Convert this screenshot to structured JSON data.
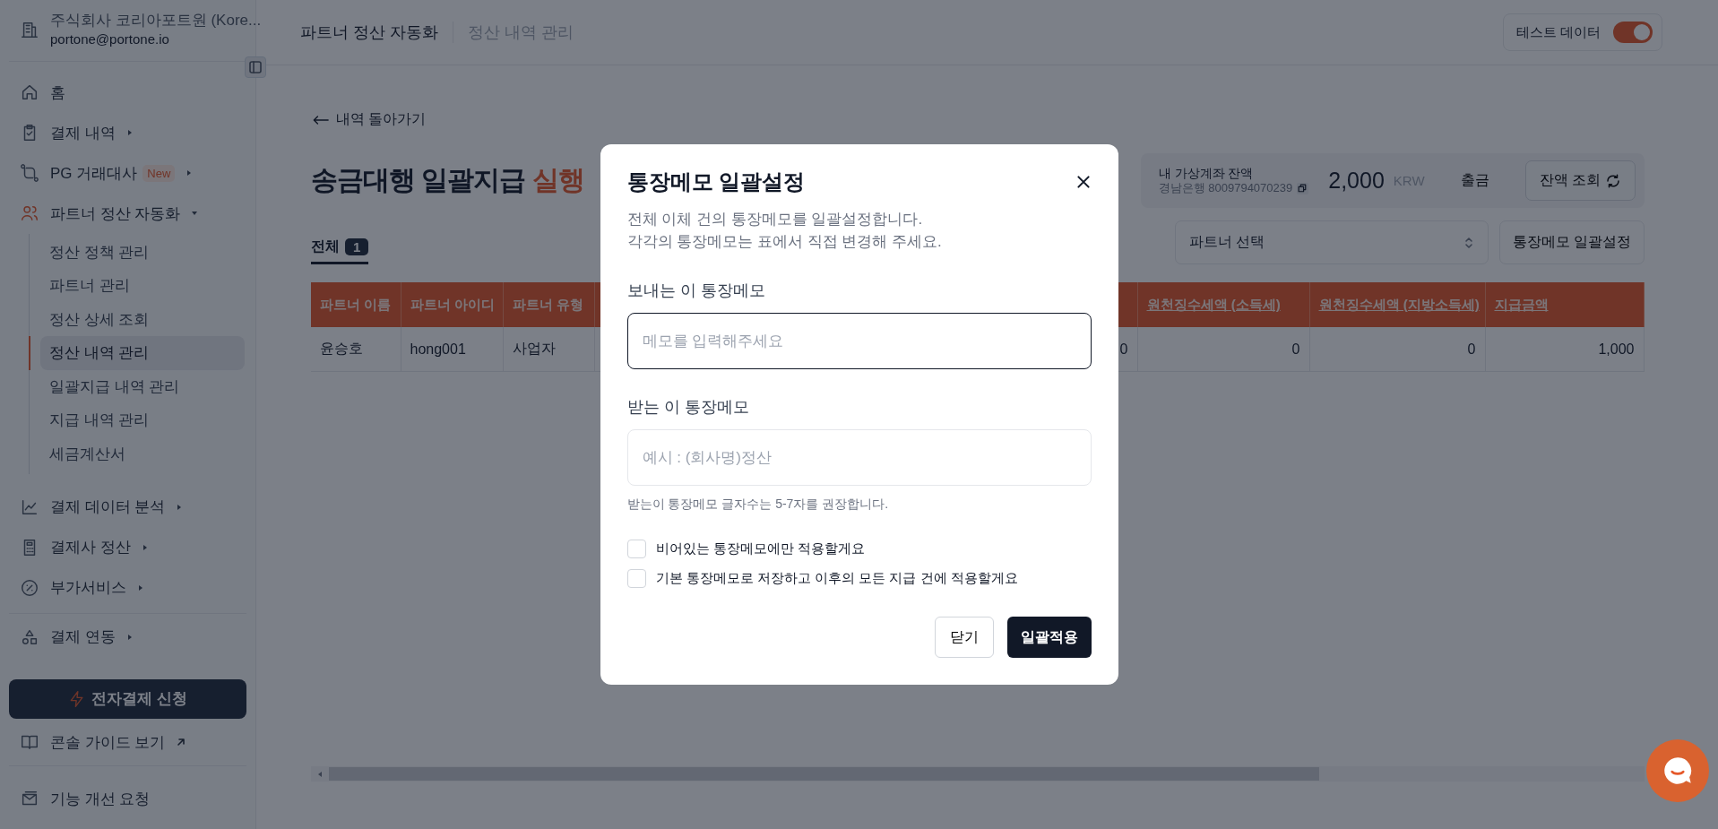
{
  "sidebar": {
    "account": {
      "company": "주식회사 코리아포트원 (Kore...",
      "email": "portone@portone.io"
    },
    "menu": [
      {
        "kind": "home",
        "label": "홈",
        "expandable": false,
        "expanded": false
      },
      {
        "kind": "receipt",
        "label": "결제 내역",
        "expandable": true,
        "expanded": false
      },
      {
        "kind": "pg",
        "label": "PG 거래대사",
        "badge": "New",
        "expandable": true,
        "expanded": false
      },
      {
        "kind": "partners",
        "label": "파트너 정산 자동화",
        "expandable": true,
        "expanded": true,
        "children": [
          {
            "label": "정산 정책 관리",
            "selected": false
          },
          {
            "label": "파트너 관리",
            "selected": false
          },
          {
            "label": "정산 상세 조회",
            "selected": false
          },
          {
            "label": "정산 내역 관리",
            "selected": true
          },
          {
            "label": "일괄지급 내역 관리",
            "selected": false
          },
          {
            "label": "지급 내역 관리",
            "selected": false
          },
          {
            "label": "세금계산서",
            "selected": false
          }
        ]
      },
      {
        "kind": "chart",
        "label": "결제 데이터 분석",
        "expandable": true,
        "expanded": false
      },
      {
        "kind": "calculator",
        "label": "결제사 정산",
        "expandable": true,
        "expanded": false
      },
      {
        "kind": "service",
        "label": "부가서비스",
        "expandable": true,
        "expanded": false
      }
    ],
    "integration_menu": [
      {
        "kind": "integration",
        "label": "결제 연동",
        "expandable": true,
        "expanded": false
      }
    ],
    "apply_button": "전자결제 신청",
    "guide_link": "콘솔 가이드 보기",
    "feedback_link": "기능 개선 요청"
  },
  "header": {
    "breadcrumbs": [
      "파트너 정산 자동화",
      "정산 내역 관리"
    ],
    "test_toggle": {
      "label": "테스트 데이터",
      "on": true
    }
  },
  "back_link": "내역 돌아가기",
  "title": {
    "text": "송금대행 일괄지급",
    "highlight": "실행"
  },
  "balance": {
    "label": "내 가상계좌 잔액",
    "account": "경남은행 8009794070239",
    "amount": "2,000",
    "currency": "KRW",
    "withdraw": "출금",
    "refresh": "잔액 조회"
  },
  "tabs": [
    {
      "label": "전체",
      "count": "1",
      "selected": true
    }
  ],
  "partner_select": {
    "placeholder": "파트너 선택"
  },
  "bulk_memo_button": "통장메모 일괄설정",
  "table": {
    "columns": [
      {
        "label": "파트너 이름",
        "underlined": false,
        "numeric": false
      },
      {
        "label": "파트너 아이디",
        "underlined": false,
        "numeric": false
      },
      {
        "label": "파트너 유형",
        "underlined": false,
        "numeric": false
      },
      {
        "numeric": true
      },
      {
        "label": "원천징수세액 (소득세)",
        "underlined": true,
        "numeric": true
      },
      {
        "label": "원천징수세액 (지방소득세)",
        "underlined": true,
        "numeric": true
      },
      {
        "label": "지급금액",
        "underlined": true,
        "numeric": true
      }
    ],
    "rows": [
      [
        "윤승호",
        "hong001",
        "사업자",
        "0",
        "0",
        "0",
        "1,000"
      ]
    ]
  },
  "modal": {
    "title": "통장메모 일괄설정",
    "description": [
      "전체 이체 건의 통장메모를 일괄설정합니다.",
      "각각의 통장메모는 표에서 직접 변경해 주세요."
    ],
    "fields": [
      {
        "label": "보내는 이 통장메모",
        "placeholder": "메모를 입력해주세요",
        "focused": true
      },
      {
        "label": "받는 이 통장메모",
        "placeholder": "예시 : (회사명)정산",
        "focused": false,
        "hint": "받는이 통장메모 글자수는 5-7자를 권장합니다."
      }
    ],
    "options": [
      {
        "label": "비어있는 통장메모에만 적용할게요",
        "checked": false
      },
      {
        "label": "기본 통장메모로 저장하고 이후의 모든 지급 건에 적용할게요",
        "checked": false
      }
    ],
    "close_button": "닫기",
    "apply_button": "일괄적용"
  }
}
